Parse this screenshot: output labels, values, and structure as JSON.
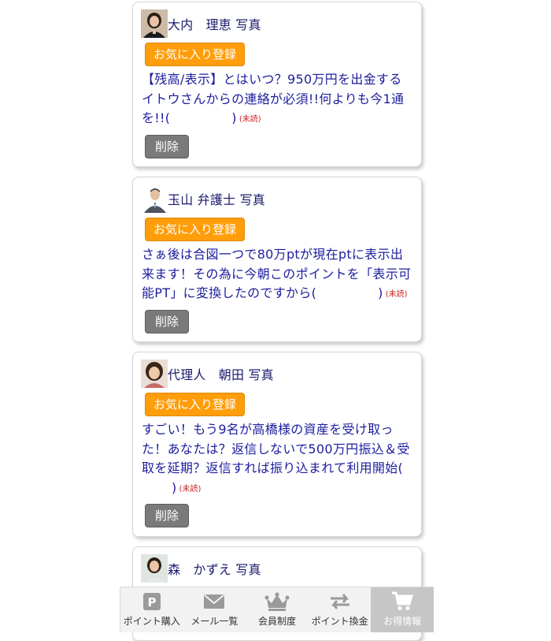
{
  "messages": [
    {
      "sender": "大内　理恵 写真",
      "avatar_icon": "woman-photo-avatar",
      "favorite_label": "お気に入り登録",
      "body": "【残高/表示】とはいつ？950万円を出金するイトウさんからの連絡が必須!!何よりも今1通を!!",
      "open_paren": "(",
      "close_paren": ")",
      "unread_label": "(未読)",
      "delete_label": "削除"
    },
    {
      "sender": "玉山 弁護士 写真",
      "avatar_icon": "man-suit-photo-avatar",
      "favorite_label": "お気に入り登録",
      "body": "さぁ後は合図一つで80万ptが現在ptに表示出来ます！その為に今朝このポイントを「表示可能PT」に変換したのですから",
      "open_paren": "(",
      "close_paren": ")",
      "unread_label": "(未読)",
      "delete_label": "削除"
    },
    {
      "sender": "代理人　朝田 写真",
      "avatar_icon": "woman-photo-avatar",
      "favorite_label": "お気に入り登録",
      "body": "すごい！もう9名が高橋様の資産を受け取った！あなたは？返信しないで500万円振込＆受取を延期？返信すれば振り込まれて利用開始",
      "open_paren": "(",
      "close_paren": ")",
      "unread_label": "(未読)",
      "delete_label": "削除"
    },
    {
      "sender": "森　かずえ 写真",
      "avatar_icon": "woman-photo-avatar"
    }
  ],
  "tabbar": {
    "tabs": [
      {
        "label": "ポイント購入",
        "icon": "p-parking-icon"
      },
      {
        "label": "メール一覧",
        "icon": "envelope-icon"
      },
      {
        "label": "会員制度",
        "icon": "crown-icon"
      },
      {
        "label": "ポイント換金",
        "icon": "exchange-arrows-icon"
      },
      {
        "label": "お得情報",
        "icon": "cart-icon",
        "active": true
      }
    ]
  },
  "colors": {
    "favorite_button": "#ff9d0a",
    "delete_button": "#7a7a7a",
    "message_text": "#1d1d9e",
    "sender_text": "#1a1a6e",
    "unread_text": "#cc2222",
    "active_tab_bg": "#c6c6c6"
  }
}
